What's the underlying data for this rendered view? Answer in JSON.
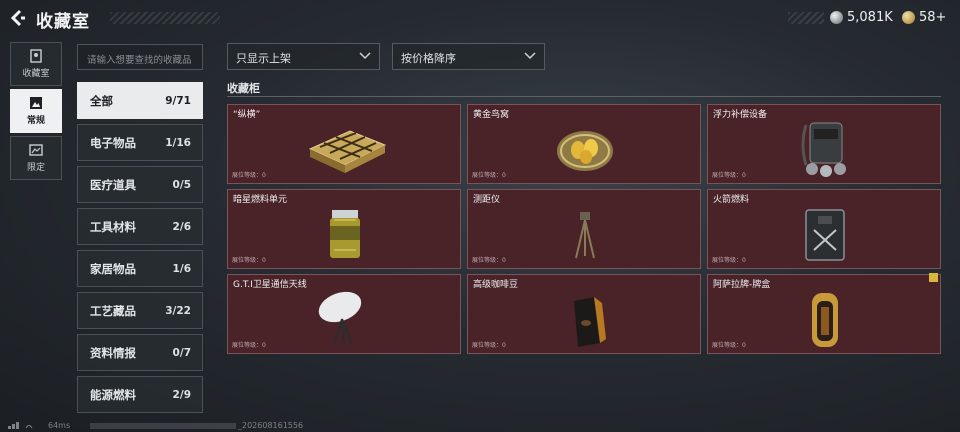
{
  "header": {
    "title": "收藏室",
    "currency": [
      {
        "icon": "silver-coin-icon",
        "value": "5,081K"
      },
      {
        "icon": "gold-coin-icon",
        "value": "58+"
      }
    ]
  },
  "leftnav": [
    {
      "label": "收藏室",
      "icon": "collection-room-icon",
      "active": false
    },
    {
      "label": "常规",
      "icon": "regular-icon",
      "active": true
    },
    {
      "label": "限定",
      "icon": "limited-icon",
      "active": false
    }
  ],
  "search": {
    "placeholder": "请输入想要查找的收藏品"
  },
  "filters": {
    "shelf_filter": "只显示上架",
    "sort": "按价格降序"
  },
  "categories": [
    {
      "name": "全部",
      "count": "9/71",
      "active": true
    },
    {
      "name": "电子物品",
      "count": "1/16"
    },
    {
      "name": "医疗道具",
      "count": "0/5"
    },
    {
      "name": "工具材料",
      "count": "2/6"
    },
    {
      "name": "家居物品",
      "count": "1/6"
    },
    {
      "name": "工艺藏品",
      "count": "3/22"
    },
    {
      "name": "资料情报",
      "count": "0/7"
    },
    {
      "name": "能源燃料",
      "count": "2/9"
    }
  ],
  "cabinet": {
    "title": "收藏柜",
    "level_label": "展位等级：0",
    "items": [
      {
        "name": "“纵横”",
        "icon": "chess-board-icon"
      },
      {
        "name": "黄金鸟窝",
        "icon": "golden-nest-icon"
      },
      {
        "name": "浮力补偿设备",
        "icon": "buoyancy-device-icon"
      },
      {
        "name": "暗星燃料单元",
        "icon": "fuel-cell-icon"
      },
      {
        "name": "测距仪",
        "icon": "rangefinder-icon"
      },
      {
        "name": "火箭燃料",
        "icon": "rocket-fuel-icon"
      },
      {
        "name": "G.T.I卫星通信天线",
        "icon": "satellite-antenna-icon"
      },
      {
        "name": "高级咖啡豆",
        "icon": "coffee-beans-icon"
      },
      {
        "name": "阿萨拉牌-牌盒",
        "icon": "card-box-icon",
        "flag": true
      }
    ]
  },
  "statusbar": {
    "ping": "64ms",
    "uid": "_202608161556"
  },
  "colors": {
    "card_bg": "#4a2329",
    "card_border": "#7a545a",
    "active_bg": "#e9ebed"
  }
}
